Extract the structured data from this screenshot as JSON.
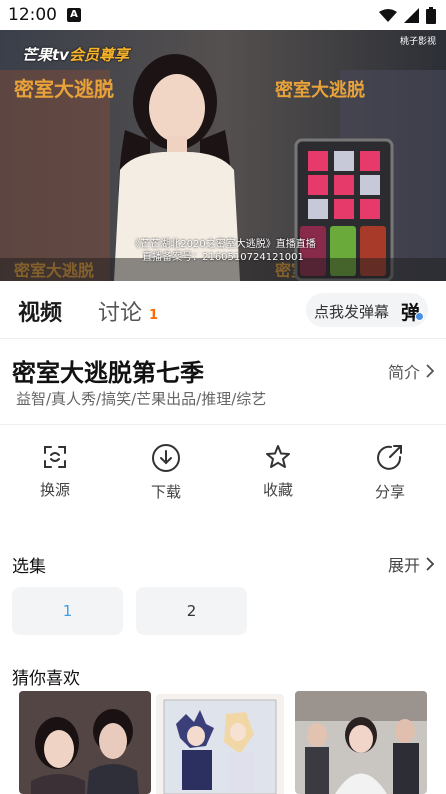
{
  "status_bar": {
    "time": "12:00",
    "notification_badge": "A"
  },
  "video": {
    "logo_prefix": "芒果tv",
    "logo_suffix": "会员尊享",
    "watermark_text": "桃子影视",
    "subtitle_line1": "《芒芒湖北2020之密室大逃脱》直播直播",
    "subtitle_line2": "直播备案号：2160510724121001"
  },
  "tabs": {
    "video_label": "视频",
    "discuss_label": "讨论",
    "discuss_count": "1",
    "danmaku_label": "点我发弹幕",
    "danmaku_icon_text": "弹"
  },
  "show": {
    "title": "密室大逃脱第七季",
    "intro_label": "简介",
    "tags": "益智/真人秀/搞笑/芒果出品/推理/综艺"
  },
  "actions": [
    {
      "label": "换源",
      "icon": "switch-source-icon"
    },
    {
      "label": "下载",
      "icon": "download-icon"
    },
    {
      "label": "收藏",
      "icon": "star-icon"
    },
    {
      "label": "分享",
      "icon": "share-icon"
    }
  ],
  "episodes": {
    "header": "选集",
    "expand_label": "展开",
    "items": [
      "1",
      "2"
    ],
    "active_color": "#3d9fe8"
  },
  "recommendations": {
    "header": "猜你喜欢"
  },
  "colors": {
    "accent": "#ff6a00",
    "active_episode": "#3d9fe8"
  }
}
